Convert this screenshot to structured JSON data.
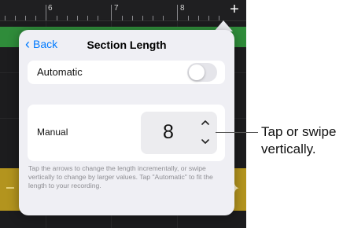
{
  "ruler": {
    "numbers": [
      "6",
      "7",
      "8"
    ]
  },
  "popover": {
    "back_label": "Back",
    "title": "Section Length",
    "automatic": {
      "label": "Automatic",
      "enabled": false
    },
    "manual": {
      "label": "Manual",
      "value": "8"
    },
    "help_text": "Tap the arrows to change the length incrementally, or swipe vertically to change by larger values. Tap \"Automatic\" to fit the length to your recording."
  },
  "callout": {
    "line1": "Tap or swipe",
    "line2": "vertically."
  },
  "colors": {
    "accent": "#007aff",
    "green_region": "#2f8c3a",
    "yellow_region": "#b3941e"
  }
}
